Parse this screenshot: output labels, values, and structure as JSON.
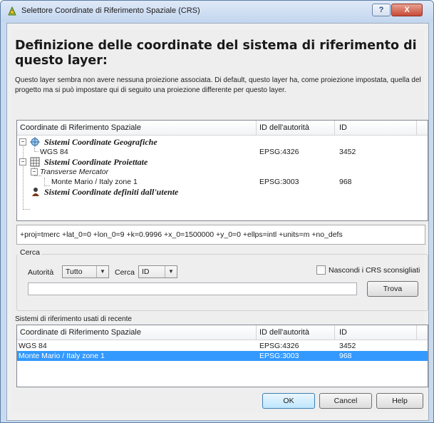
{
  "window": {
    "title": "Selettore Coordinate di Riferimento Spaziale (CRS)",
    "help_label": "?",
    "close_label": "X"
  },
  "heading": "Definizione delle coordinate del sistema di riferimento di questo layer:",
  "description": "Questo layer sembra non avere nessuna proiezione associata. Di default, questo layer ha, come proiezione impostata, quella del progetto ma si può impostare qui di seguito una proiezione differente per questo layer.",
  "columns": {
    "crs": "Coordinate di Riferimento Spaziale",
    "authority_id": "ID dell'autorità",
    "id": "ID"
  },
  "tree": {
    "geo_group": "Sistemi Coordinate Geografiche",
    "wgs84": {
      "name": "WGS 84",
      "auth": "EPSG:4326",
      "id": "3452"
    },
    "proj_group": "Sistemi Coordinate Proiettate",
    "tm": "Transverse Mercator",
    "monte_mario": {
      "name": "Monte Mario / Italy zone 1",
      "auth": "EPSG:3003",
      "id": "968"
    },
    "user_group": "Sistemi Coordinate definiti dall'utente"
  },
  "proj_string": "+proj=tmerc +lat_0=0 +lon_0=9 +k=0.9996 +x_0=1500000 +y_0=0 +ellps=intl +units=m +no_defs",
  "search": {
    "group_label": "Cerca",
    "authority_label": "Autorità",
    "authority_value": "Tutto",
    "search_label": "Cerca",
    "search_value": "ID",
    "hide_deprecated_label": "Nascondi i CRS sconsigliati",
    "find_button": "Trova",
    "input_value": ""
  },
  "recent": {
    "label": "Sistemi di riferimento usati di recente",
    "rows": [
      {
        "name": "WGS 84",
        "auth": "EPSG:4326",
        "id": "3452"
      },
      {
        "name": "Monte Mario / Italy zone 1",
        "auth": "EPSG:3003",
        "id": "968"
      }
    ]
  },
  "buttons": {
    "ok": "OK",
    "cancel": "Cancel",
    "help": "Help"
  }
}
